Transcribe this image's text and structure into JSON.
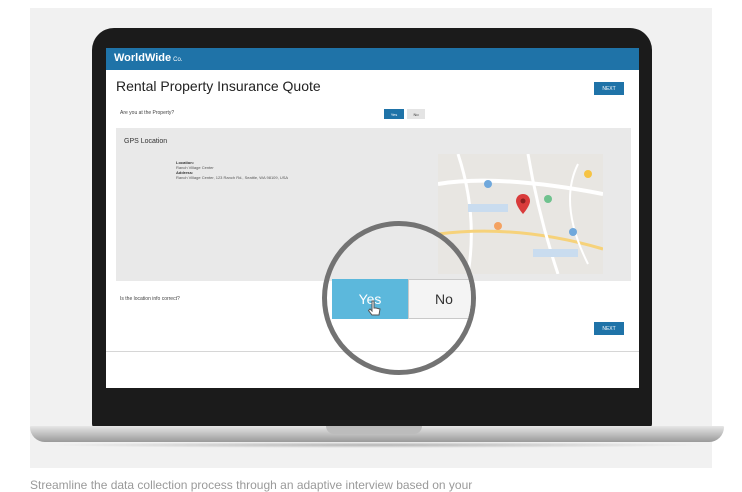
{
  "app": {
    "logo_text": "WorldWide",
    "logo_suffix": "Co.",
    "title": "Rental Property Insurance Quote",
    "top_button": "NEXT",
    "accent_color": "#1f73a8"
  },
  "question_at_property": {
    "label": "Are you at the Property?",
    "yes": "Yes",
    "no": "No"
  },
  "gps": {
    "title": "GPS Location",
    "location_label": "Location:",
    "location_value": "Ranch Village Center",
    "address_label": "Address:",
    "address_value": "Ranch Village Center, 123 Ranch Rd., Seattle, WA 98109, USA"
  },
  "question_correct": {
    "label": "Is the location info correct?"
  },
  "bottom_button": "NEXT",
  "zoom": {
    "yes": "Yes",
    "no": "No",
    "yes_color": "#5cb8dc"
  },
  "caption": "Streamline the data collection process through an adaptive interview based on your"
}
